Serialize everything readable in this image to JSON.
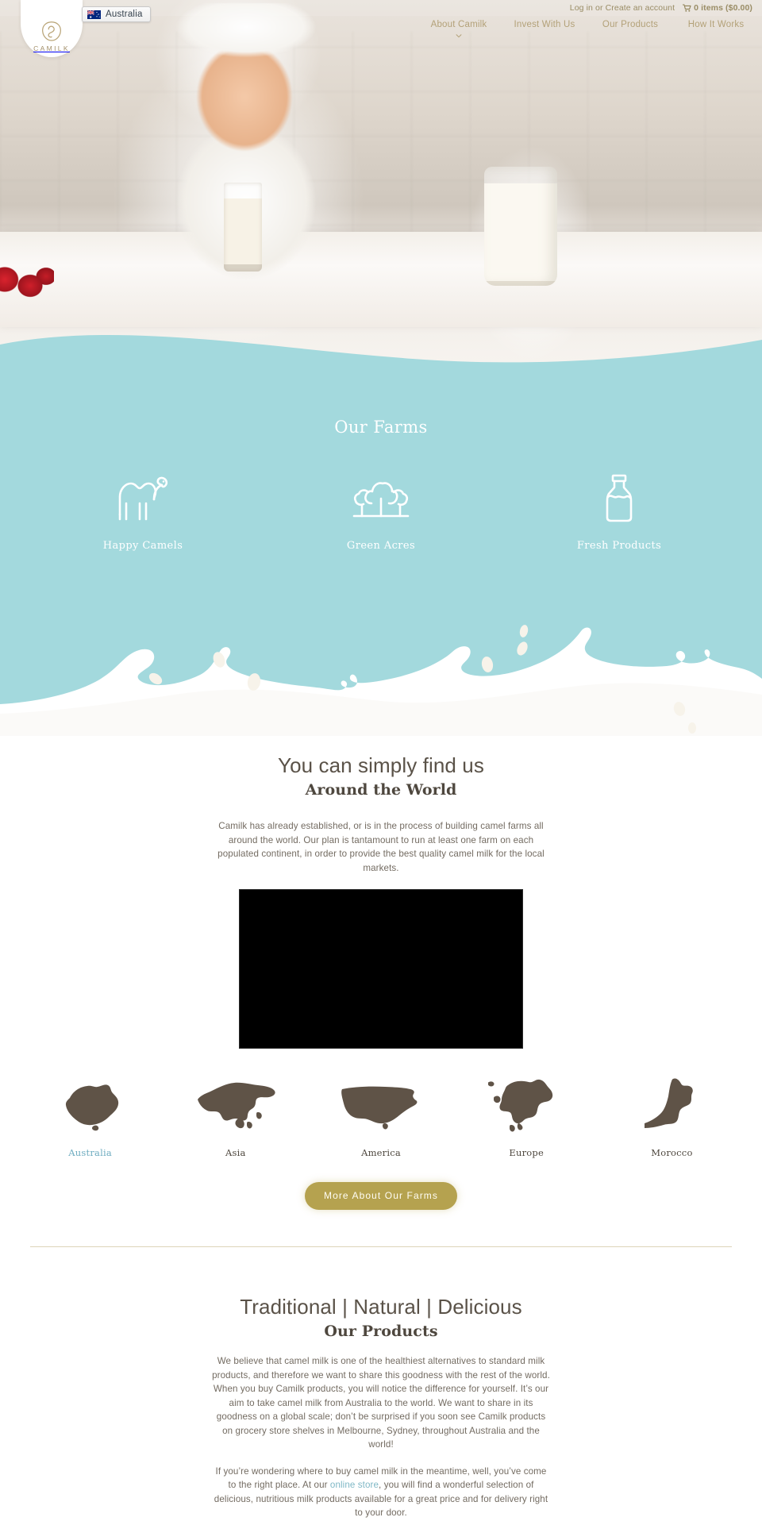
{
  "topbar": {
    "login_text": "Log in",
    "or_text": "or",
    "create_account_text": "Create an account",
    "cart_text": "0 items ($0.00)",
    "cart_icon": "shopping-cart-icon"
  },
  "logo": {
    "wordmark": "CAMILK",
    "mark_icon": "camel-head-logo-icon"
  },
  "country_selector": {
    "label": "Australia",
    "flag_icon": "australia-flag-icon"
  },
  "nav": {
    "items": [
      {
        "label": "About Camilk",
        "has_dropdown": true,
        "chevron_icon": "chevron-down-icon"
      },
      {
        "label": "Invest With Us",
        "has_dropdown": false
      },
      {
        "label": "Our Products",
        "has_dropdown": false
      },
      {
        "label": "How It Works",
        "has_dropdown": false
      }
    ]
  },
  "farms": {
    "heading": "Our Farms",
    "background_color": "#a3d9dd",
    "cards": [
      {
        "label": "Happy Camels",
        "icon": "camel-icon"
      },
      {
        "label": "Green Acres",
        "icon": "trees-icon"
      },
      {
        "label": "Fresh Products",
        "icon": "milk-bottle-icon"
      }
    ],
    "splash_graphic": "milk-splash-graphic"
  },
  "world": {
    "heading_line1": "You can simply find us",
    "heading_line2": "Around the World",
    "paragraph": "Camilk has already established, or is in the process of building camel farms all around the world. Our plan is tantamount to run at least one farm on each populated continent, in order to provide the best quality camel milk for the local markets.",
    "video_placeholder": "video-player",
    "regions": [
      {
        "label": "Australia",
        "icon": "australia-map-icon",
        "active": true
      },
      {
        "label": "Asia",
        "icon": "asia-map-icon",
        "active": false
      },
      {
        "label": "America",
        "icon": "america-map-icon",
        "active": false
      },
      {
        "label": "Europe",
        "icon": "europe-map-icon",
        "active": false
      },
      {
        "label": "Morocco",
        "icon": "morocco-map-icon",
        "active": false
      }
    ],
    "cta_label": "More About Our Farms",
    "map_color": "#5f5347",
    "active_color": "#6eacc0"
  },
  "products": {
    "heading_line1": "Traditional | Natural | Delicious",
    "heading_line2": "Our Products",
    "paragraph1": "We believe that camel milk is one of the healthiest alternatives to standard milk products, and therefore we want to share this goodness with the rest of the world. When you buy Camilk products, you will notice the difference for yourself. It’s our aim to take camel milk from Australia to the world. We want to share in its goodness on a global scale; don’t be surprised if you soon see Camilk products on grocery store shelves in Melbourne, Sydney, throughout Australia and the world!",
    "paragraph2_before": "If you’re wondering where to buy camel milk in the meantime, well, you’ve come to the right place. At our ",
    "paragraph2_link": "online store",
    "paragraph2_after": ", you will find a wonderful selection of delicious, nutritious milk products available for a great price and for delivery right to your door."
  }
}
